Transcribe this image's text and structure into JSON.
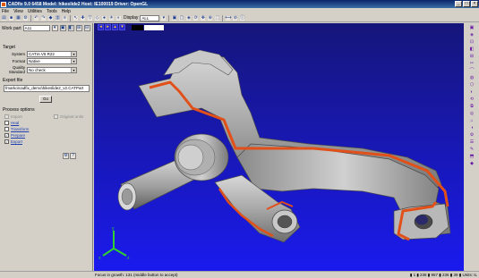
{
  "window": {
    "title": "CADfix 9.0 6458  Model: hikeslide2  Host: IE100019  Driver: OpenGL",
    "buttons": [
      "_",
      "□",
      "×"
    ]
  },
  "menu": [
    "File",
    "View",
    "Utilities",
    "Tools",
    "Help"
  ],
  "toolbar": {
    "display_label": "Display",
    "display_value": "ALL"
  },
  "work_part": {
    "label": "Work part",
    "value": "A11"
  },
  "target": {
    "group_title": "Target",
    "system_label": "System",
    "system_value": "CATIA V5 R22",
    "format_label": "Format",
    "format_value": "Native",
    "quality_label": "Quality Standard",
    "quality_value": "No check"
  },
  "export": {
    "group_title": "Export file",
    "path": "fmarko\\cadfix_demo\\hikeslide2_v2.CATPart",
    "go_label": "Go"
  },
  "process": {
    "group_title": "Process options",
    "options": [
      {
        "label": "Import",
        "checked": false,
        "enabled": false
      },
      {
        "label": "Heal",
        "checked": false,
        "enabled": true
      },
      {
        "label": "Transform",
        "checked": false,
        "enabled": true
      },
      {
        "label": "Prepare",
        "checked": true,
        "enabled": true
      },
      {
        "label": "Export",
        "checked": true,
        "enabled": true
      }
    ],
    "original_units_label": "Original units"
  },
  "status": {
    "message": "Focus in growth: 131    (middle button to accept)",
    "right": "▮ 1 ▮ 236 ▮ 957 ▮ 236 ▮ 39 ▮ Units: IL"
  },
  "colors": {
    "titlebar": "#0a246a",
    "viewport_top": "#16167a",
    "viewport_bottom": "#1a1aee",
    "model_gray": "#a8a8a8",
    "edge_orange": "#e2501a",
    "link_blue": "#1f3fb0"
  }
}
